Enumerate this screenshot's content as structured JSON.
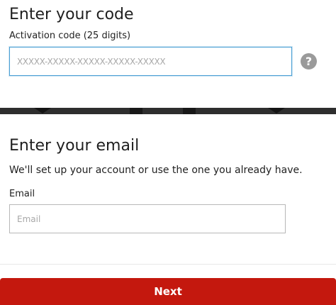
{
  "code_section": {
    "heading": "Enter your code",
    "field_label": "Activation code (25 digits)",
    "field_placeholder": "XXXXX-XXXXX-XXXXX-XXXXX-XXXXX",
    "field_value": "",
    "help_icon": "question-circle-icon",
    "help_glyph": "?"
  },
  "email_section": {
    "heading": "Enter your email",
    "description": "We'll set up your account or use the one you already have.",
    "field_label": "Email",
    "field_placeholder": "Email",
    "field_value": ""
  },
  "footer": {
    "next_label": "Next"
  },
  "colors": {
    "primary_button": "#c4180e",
    "focus_border": "#4a9fd4",
    "help_icon": "#9a9a9a",
    "divider": "#2e2e2e"
  }
}
